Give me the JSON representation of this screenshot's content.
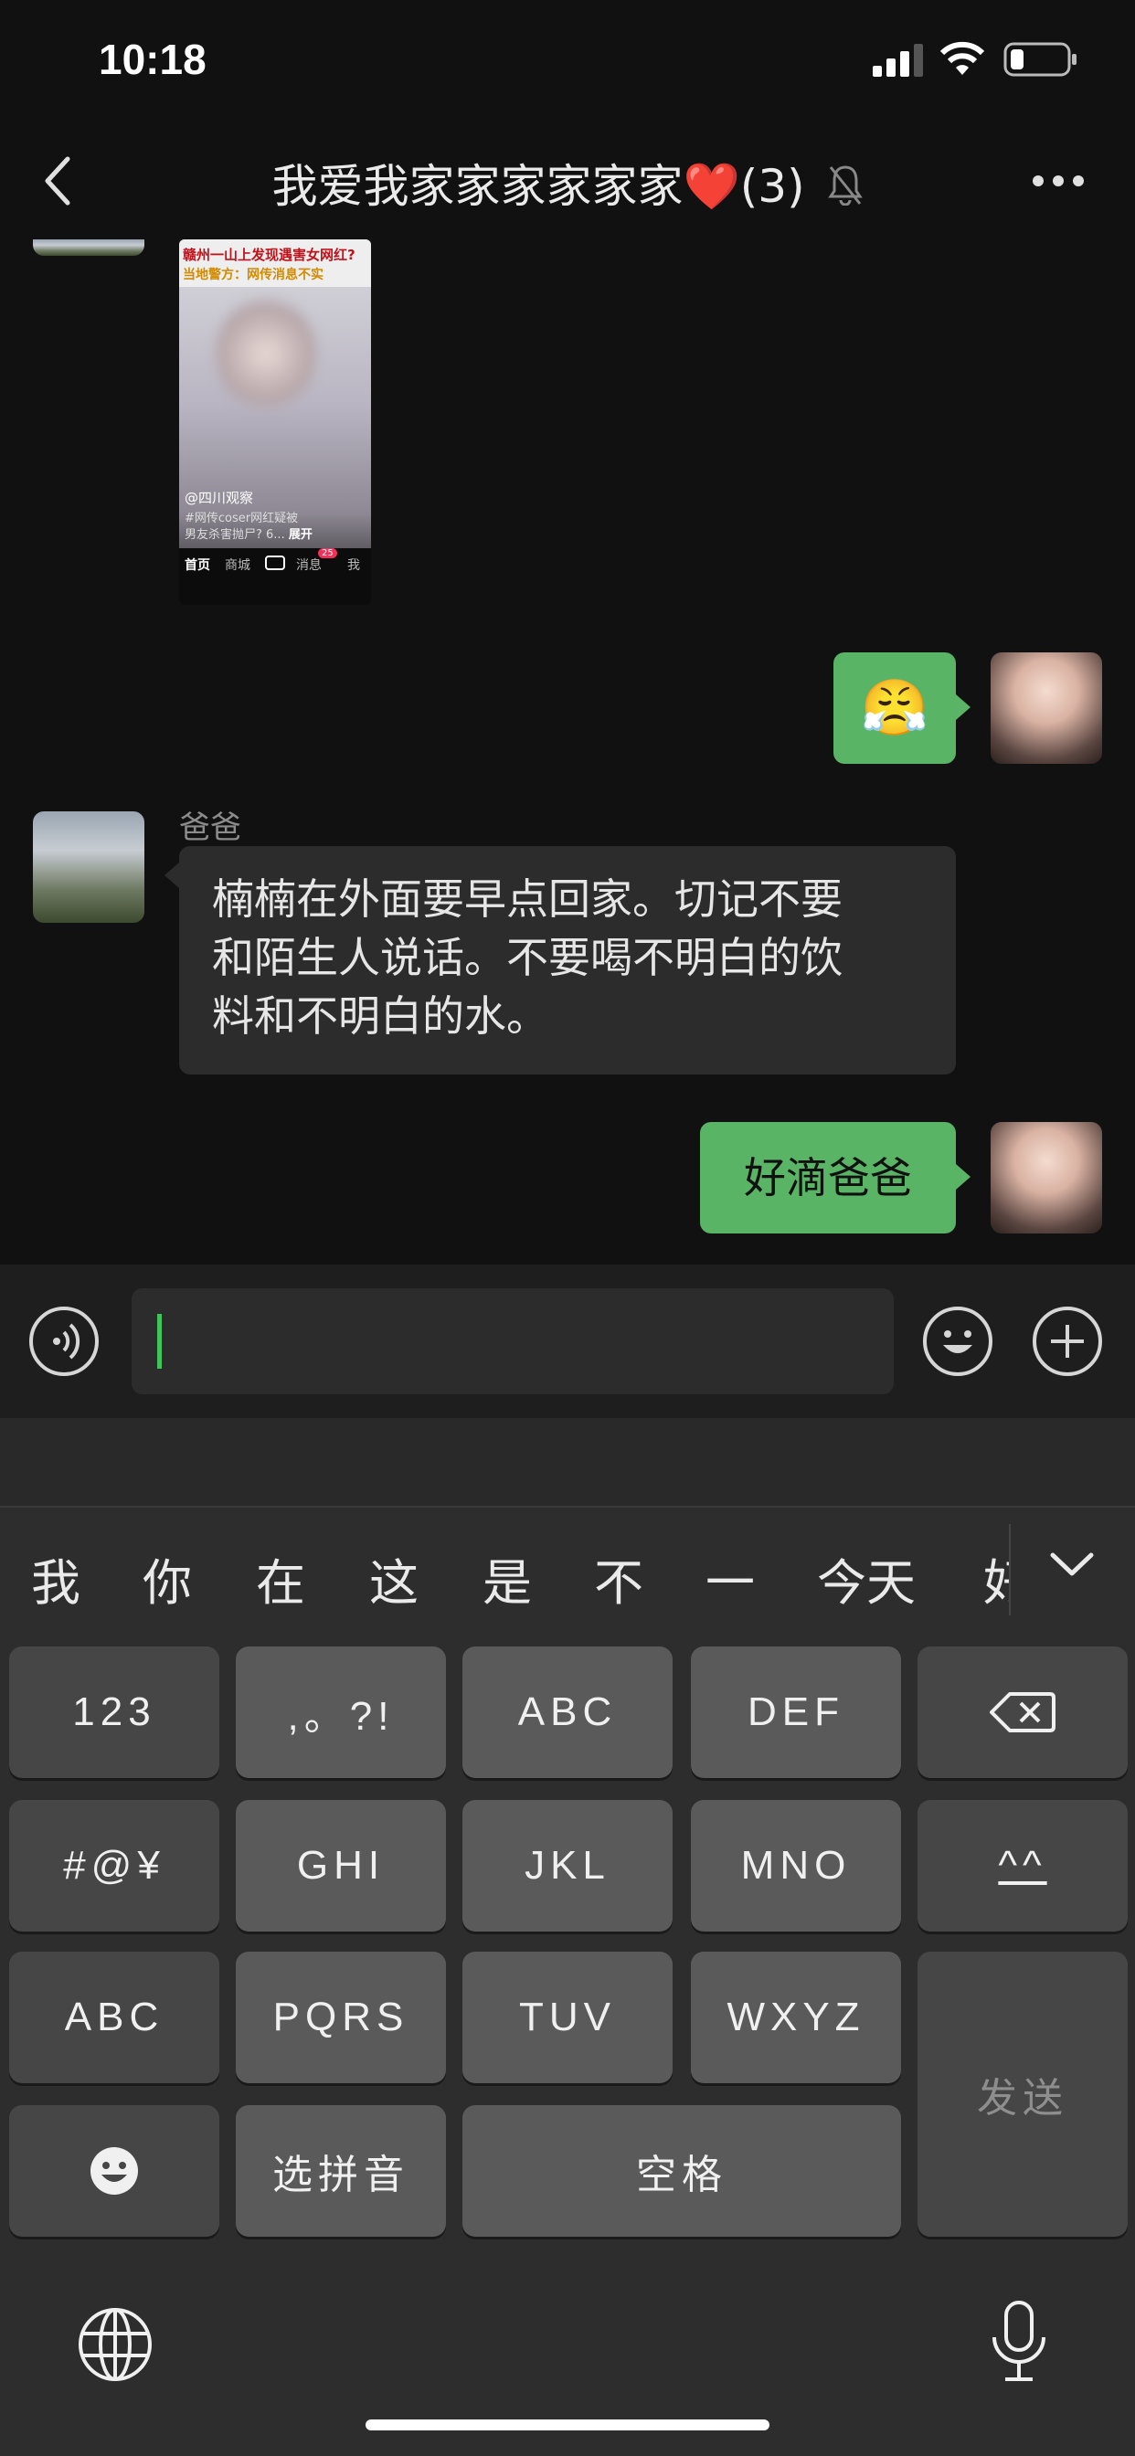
{
  "status_bar": {
    "time": "10:18"
  },
  "nav": {
    "title_text": "我爱我家家家家家家",
    "heart": "❤️",
    "member_count": "(3)"
  },
  "shared_image": {
    "headline_1": "赣州一山上发现遇害女网红?",
    "headline_2": "当地警方：网传消息不实",
    "account": "@四川观察",
    "caption_1": "#网传coser网红疑被",
    "caption_2": "男友杀害抛尸? 6...",
    "expand": "展开",
    "nav_home": "首页",
    "nav_mall": "商城",
    "nav_msg": "消息",
    "nav_me": "我",
    "msg_badge": "25"
  },
  "messages": [
    {
      "sender": "me",
      "type": "emoji",
      "content": "😤"
    },
    {
      "sender": "爸爸",
      "type": "text",
      "lines": [
        "楠楠在外面要早点回家。切记不要",
        "和陌生人说话。不要喝不明白的饮",
        "料和不明白的水。"
      ]
    },
    {
      "sender": "me",
      "type": "text",
      "content": "好滴爸爸"
    }
  ],
  "keyboard": {
    "candidates": [
      "我",
      "你",
      "在",
      "这",
      "是",
      "不",
      "一",
      "今天",
      "好"
    ],
    "keys": {
      "k123": "123",
      "punct": ",。?!",
      "abc2": "ABC",
      "def": "DEF",
      "symbols": "#@¥",
      "ghi": "GHI",
      "jkl": "JKL",
      "mno": "MNO",
      "caret_face": "^^",
      "abc": "ABC",
      "pqrs": "PQRS",
      "tuv": "TUV",
      "wxyz": "WXYZ",
      "send": "发送",
      "pinyin": "选拼音",
      "space": "空格"
    }
  },
  "colors": {
    "accent_green": "#59b465",
    "caret_green": "#3fc45a",
    "heart_red": "#e52d3a"
  }
}
